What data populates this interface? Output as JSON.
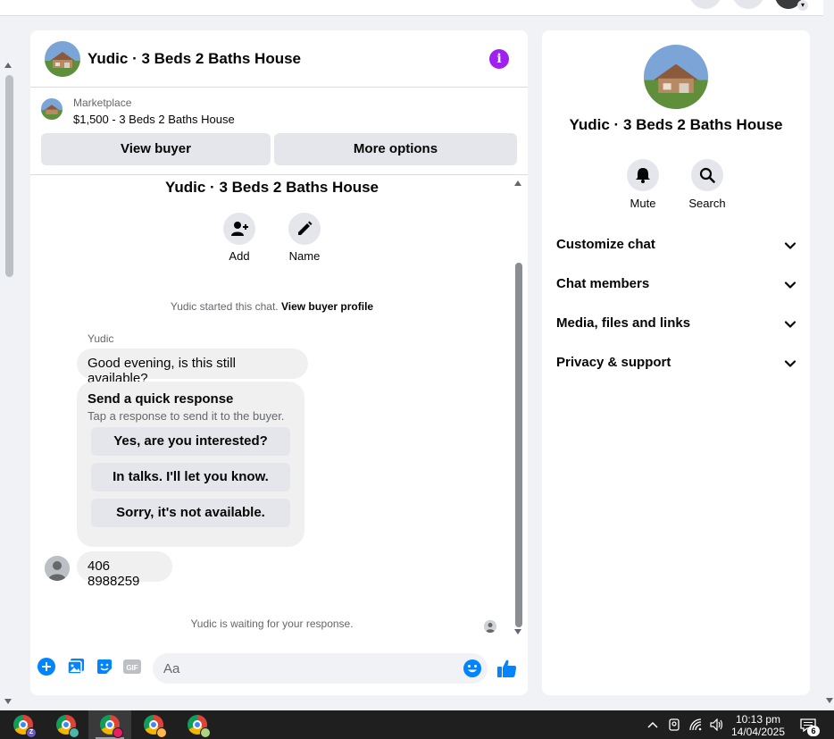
{
  "chat": {
    "title": "Yudic · 3 Beds 2 Baths House",
    "listing_label": "Marketplace",
    "listing_price_title": "$1,500 - 3 Beds 2 Baths House",
    "view_buyer": "View buyer",
    "more_options": "More options"
  },
  "conversation": {
    "title": "Yudic · 3 Beds 2 Baths House",
    "add_label": "Add",
    "name_label": "Name",
    "started_text": "Yudic started this chat. ",
    "started_link": "View buyer profile",
    "sender_name": "Yudic",
    "message_1": "Good evening, is this still available?",
    "quick_title": "Send a quick response",
    "quick_subtitle": "Tap a response to send it to the buyer.",
    "quick_options": [
      "Yes, are you interested?",
      "In talks. I'll let you know.",
      "Sorry, it's not available."
    ],
    "message_2": "406 8988259",
    "waiting_text": "Yudic is waiting for your response."
  },
  "composer": {
    "placeholder": "Aa",
    "gif_label": "GIF"
  },
  "info_panel": {
    "title": "Yudic · 3 Beds 2 Baths House",
    "mute_label": "Mute",
    "search_label": "Search",
    "sections": [
      "Customize chat",
      "Chat members",
      "Media, files and links",
      "Privacy & support"
    ]
  },
  "taskbar": {
    "time": "10:13 pm",
    "date": "14/04/2025",
    "notification_count": "6",
    "apps": [
      {
        "icon": "chrome-icon",
        "badge": "Z",
        "badge_color": "#6a5acd"
      },
      {
        "icon": "chrome-icon",
        "badge": "",
        "badge_color": "#4db6ac"
      },
      {
        "icon": "chrome-icon",
        "badge": "",
        "badge_color": "#e91e63"
      },
      {
        "icon": "chrome-icon",
        "badge": "",
        "badge_color": "#ffb74d"
      },
      {
        "icon": "chrome-icon",
        "badge": "",
        "badge_color": "#aed581"
      }
    ]
  },
  "colors": {
    "accent_purple": "#a020f0",
    "messenger_blue": "#0084ff"
  }
}
